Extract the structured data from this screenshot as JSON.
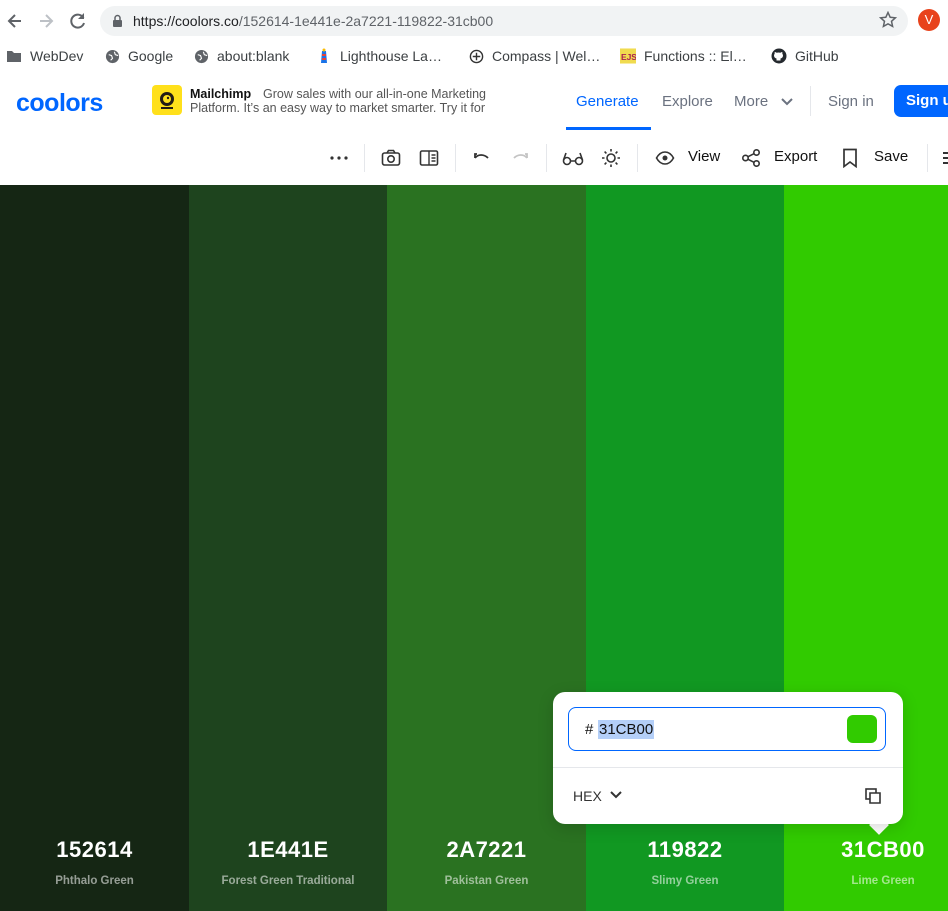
{
  "browser": {
    "url_host": "https://coolors.co",
    "url_path": "/152614-1e441e-2a7221-119822-31cb00",
    "profile_initial": "V"
  },
  "bookmarks": [
    {
      "label": "WebDev",
      "icon": "folder-icon"
    },
    {
      "label": "Google",
      "icon": "globe-icon"
    },
    {
      "label": "about:blank",
      "icon": "globe-icon"
    },
    {
      "label": "Lighthouse La…",
      "icon": "lighthouse-icon"
    },
    {
      "label": "Compass | Wel…",
      "icon": "compass-icon"
    },
    {
      "label": "Functions :: El…",
      "icon": "ejs-icon"
    },
    {
      "label": "GitHub",
      "icon": "github-icon"
    }
  ],
  "header": {
    "logo": "coolors",
    "ad": {
      "brand": "Mailchimp",
      "text_line1": "Grow sales with our all-in-one Marketing",
      "text_line2": "Platform. It’s an easy way to market smarter. Try it for"
    },
    "nav": {
      "generate": "Generate",
      "explore": "Explore",
      "more": "More"
    },
    "signin": "Sign in",
    "signup": "Sign up"
  },
  "toolbar": {
    "view": "View",
    "export": "Export",
    "save": "Save"
  },
  "colors": {
    "accent": "#0066ff"
  },
  "palette": [
    {
      "hex": "152614",
      "name": "Phthalo Green",
      "color": "#152614"
    },
    {
      "hex": "1E441E",
      "name": "Forest Green Traditional",
      "color": "#1e441e"
    },
    {
      "hex": "2A7221",
      "name": "Pakistan Green",
      "color": "#2a7221"
    },
    {
      "hex": "119822",
      "name": "Slimy Green",
      "color": "#119822"
    },
    {
      "hex": "31CB00",
      "name": "Lime Green",
      "color": "#31cb00"
    }
  ],
  "picker": {
    "hash": "#",
    "value": "31CB00",
    "mode": "HEX",
    "preview_color": "#31cb00"
  }
}
